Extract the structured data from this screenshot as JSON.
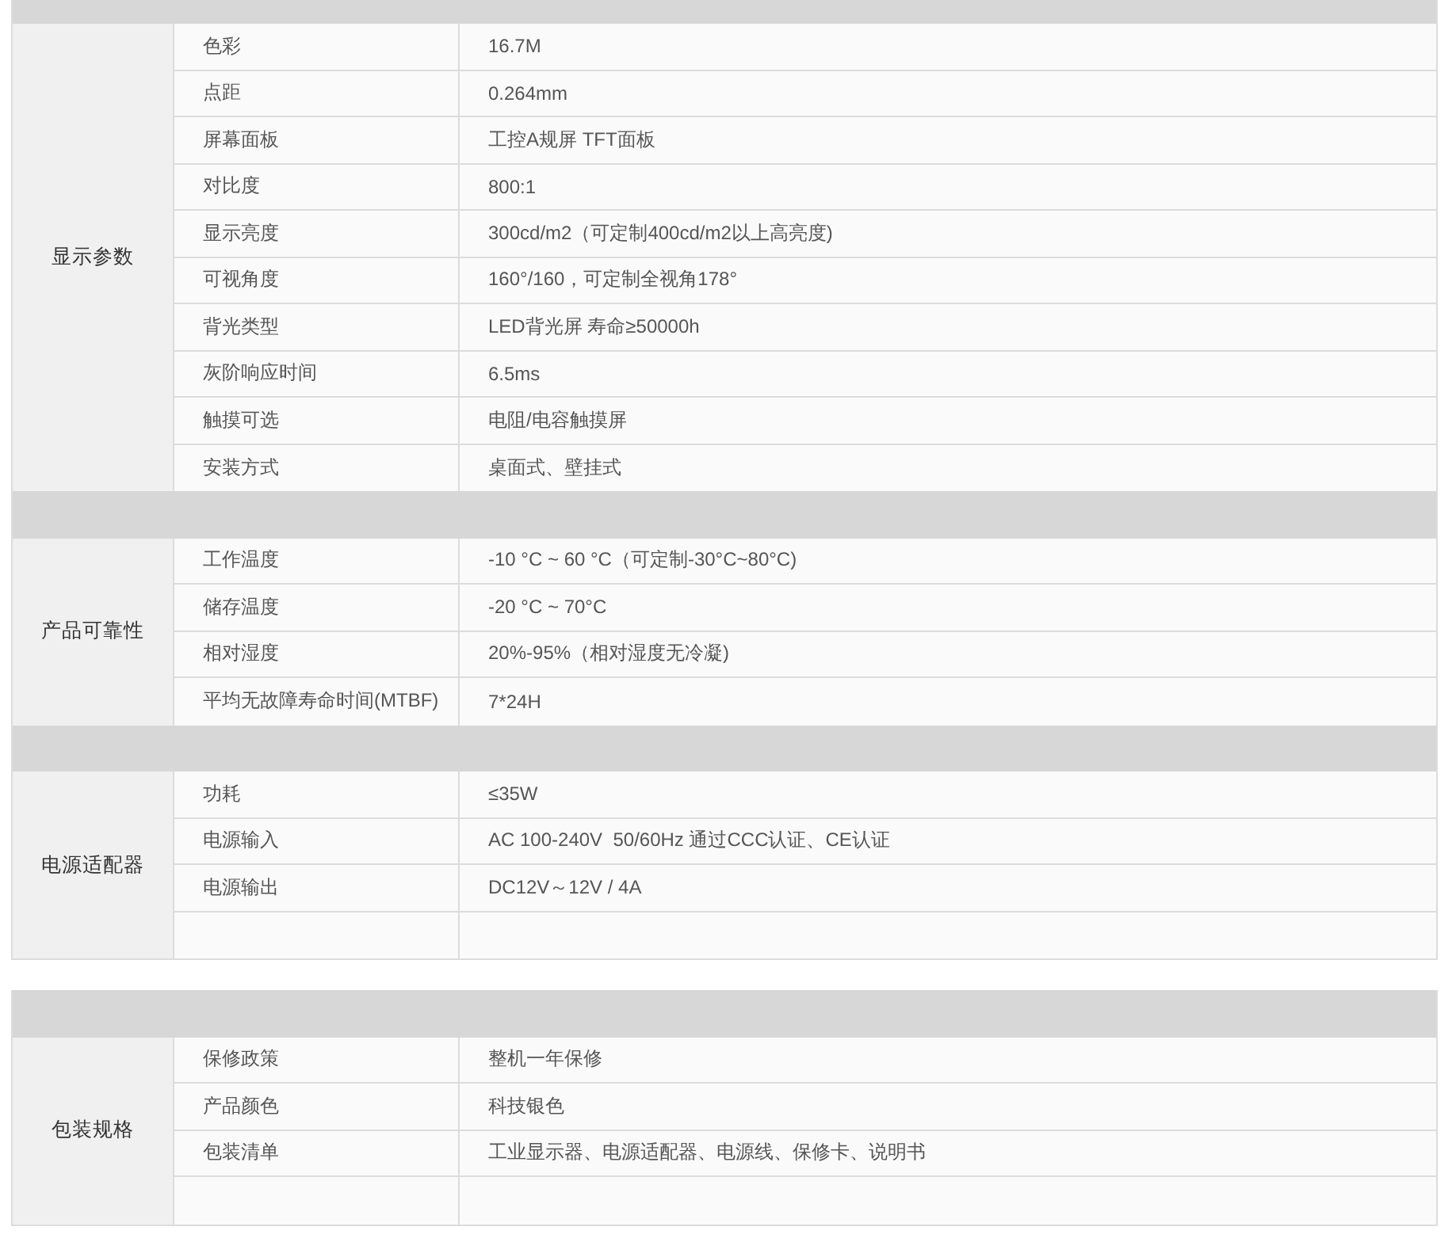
{
  "tables": [
    {
      "sections": [
        {
          "group": "显示参数",
          "rows": [
            {
              "label": "色彩",
              "value": "16.7M"
            },
            {
              "label": "点距",
              "value": "0.264mm"
            },
            {
              "label": "屏幕面板",
              "value": "工控A规屏 TFT面板"
            },
            {
              "label": "对比度",
              "value": "800:1"
            },
            {
              "label": "显示亮度",
              "value": "300cd/m2（可定制400cd/m2以上高亮度)"
            },
            {
              "label": "可视角度",
              "value": "160°/160，可定制全视角178°"
            },
            {
              "label": "背光类型",
              "value": "LED背光屏 寿命≥50000h"
            },
            {
              "label": "灰阶响应时间",
              "value": "6.5ms"
            },
            {
              "label": "触摸可选",
              "value": "电阻/电容触摸屏"
            },
            {
              "label": "安装方式",
              "value": "桌面式、壁挂式"
            }
          ]
        },
        {
          "group": "产品可靠性",
          "rows": [
            {
              "label": "工作温度",
              "value": "-10 °C ~ 60 °C（可定制-30°C~80°C)"
            },
            {
              "label": "储存温度",
              "value": "-20 °C ~ 70°C"
            },
            {
              "label": "相对湿度",
              "value": "20%-95%（相对湿度无冷凝)"
            },
            {
              "label": "平均无故障寿命时间(MTBF)",
              "value": "7*24H"
            }
          ]
        },
        {
          "group": "电源适配器",
          "rows": [
            {
              "label": "功耗",
              "value": "≤35W"
            },
            {
              "label": "电源输入",
              "value": "AC 100-240V  50/60Hz 通过CCC认证、CE认证"
            },
            {
              "label": "电源输出",
              "value": "DC12V～12V / 4A"
            },
            {}
          ]
        }
      ]
    },
    {
      "sections": [
        {
          "group": "包装规格",
          "rows": [
            {
              "label": "保修政策",
              "value": "整机一年保修"
            },
            {
              "label": "产品颜色",
              "value": "科技银色"
            },
            {
              "label": "包装清单",
              "value": "工业显示器、电源适配器、电源线、保修卡、说明书"
            },
            {}
          ]
        }
      ]
    }
  ]
}
